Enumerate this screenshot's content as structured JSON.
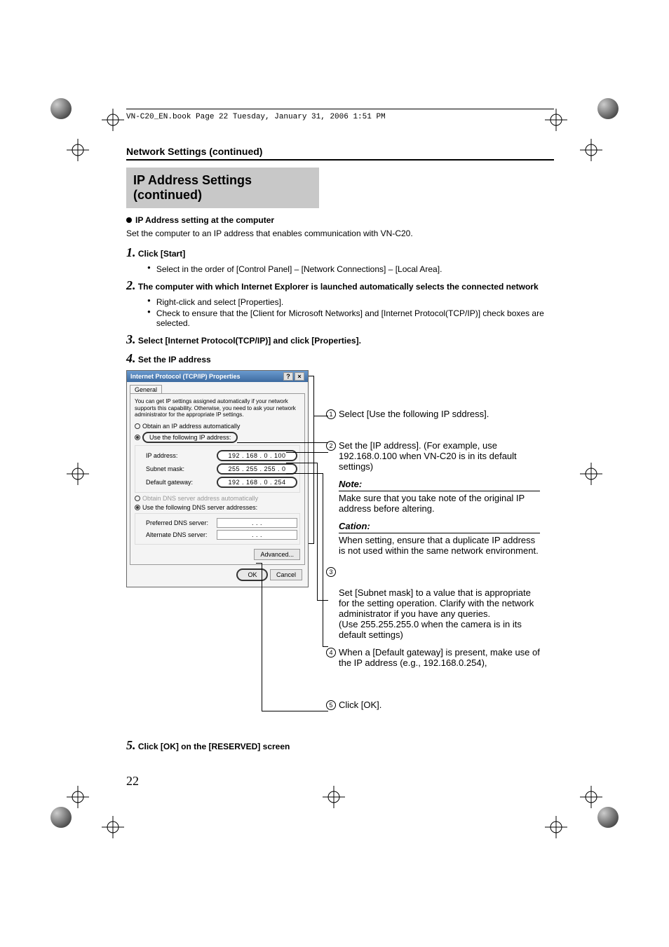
{
  "meta": "VN-C20_EN.book  Page 22  Tuesday, January 31, 2006  1:51 PM",
  "section": "Network Settings (continued)",
  "banner": "IP Address Settings (continued)",
  "subhead": "IP Address setting at the computer",
  "intro": "Set the computer to an IP address that enables communication with VN-C20.",
  "steps": {
    "s1": {
      "num": "1.",
      "title": "Click [Start]",
      "b1": "Select in the order of [Control Panel] – [Network Connections] – [Local Area]."
    },
    "s2": {
      "num": "2.",
      "title": "The computer with which Internet Explorer is launched automatically selects the connected network",
      "b1": "Right-click and select [Properties].",
      "b2": "Check to ensure that the [Client for Microsoft Networks] and [Internet Protocol(TCP/IP)] check boxes are selected."
    },
    "s3": {
      "num": "3.",
      "title": "Select [Internet Protocol(TCP/IP)] and click [Properties]."
    },
    "s4": {
      "num": "4.",
      "title": "Set the IP address"
    },
    "s5": {
      "num": "5.",
      "title": "Click [OK] on the [RESERVED] screen"
    }
  },
  "dialog": {
    "title": "Internet Protocol (TCP/IP) Properties",
    "tab": "General",
    "intro": "You can get IP settings assigned automatically if your network supports this capability. Otherwise, you need to ask your network administrator for the appropriate IP settings.",
    "radio1": "Obtain an IP address automatically",
    "radio2": "Use the following IP address:",
    "ip_label": "IP address:",
    "ip_val": "192 . 168 .   0  . 100",
    "subnet_label": "Subnet mask:",
    "subnet_val": "255 . 255 . 255 .   0",
    "gw_label": "Default gateway:",
    "gw_val": "192 . 168 .   0  . 254",
    "radio3": "Obtain DNS server address automatically",
    "radio4": "Use the following DNS server addresses:",
    "pdns_label": "Preferred DNS server:",
    "pdns_val": ".       .       .",
    "adns_label": "Alternate DNS server:",
    "adns_val": ".       .       .",
    "adv": "Advanced...",
    "ok": "OK",
    "cancel": "Cancel"
  },
  "annot": {
    "a1": "Select [Use the following IP sddress].",
    "a2": "Set the [IP address]. (For example, use 192.168.0.100 when VN-C20 is in its default settings)",
    "note_label": "Note:",
    "note": "Make sure that you take note of the original IP address before altering.",
    "caution_label": "Cation:",
    "caution": "When setting, ensure that a duplicate IP address is not used within the same network environment.",
    "a3": "Set [Subnet mask] to a value that is appropriate for the setting operation. Clarify with the network administrator if you have any queries.\n(Use 255.255.255.0 when the camera is in its default settings)",
    "a4": "When a [Default gateway] is present, make use of the IP address (e.g., 192.168.0.254),",
    "a5": "Click [OK]."
  },
  "pagenum": "22"
}
